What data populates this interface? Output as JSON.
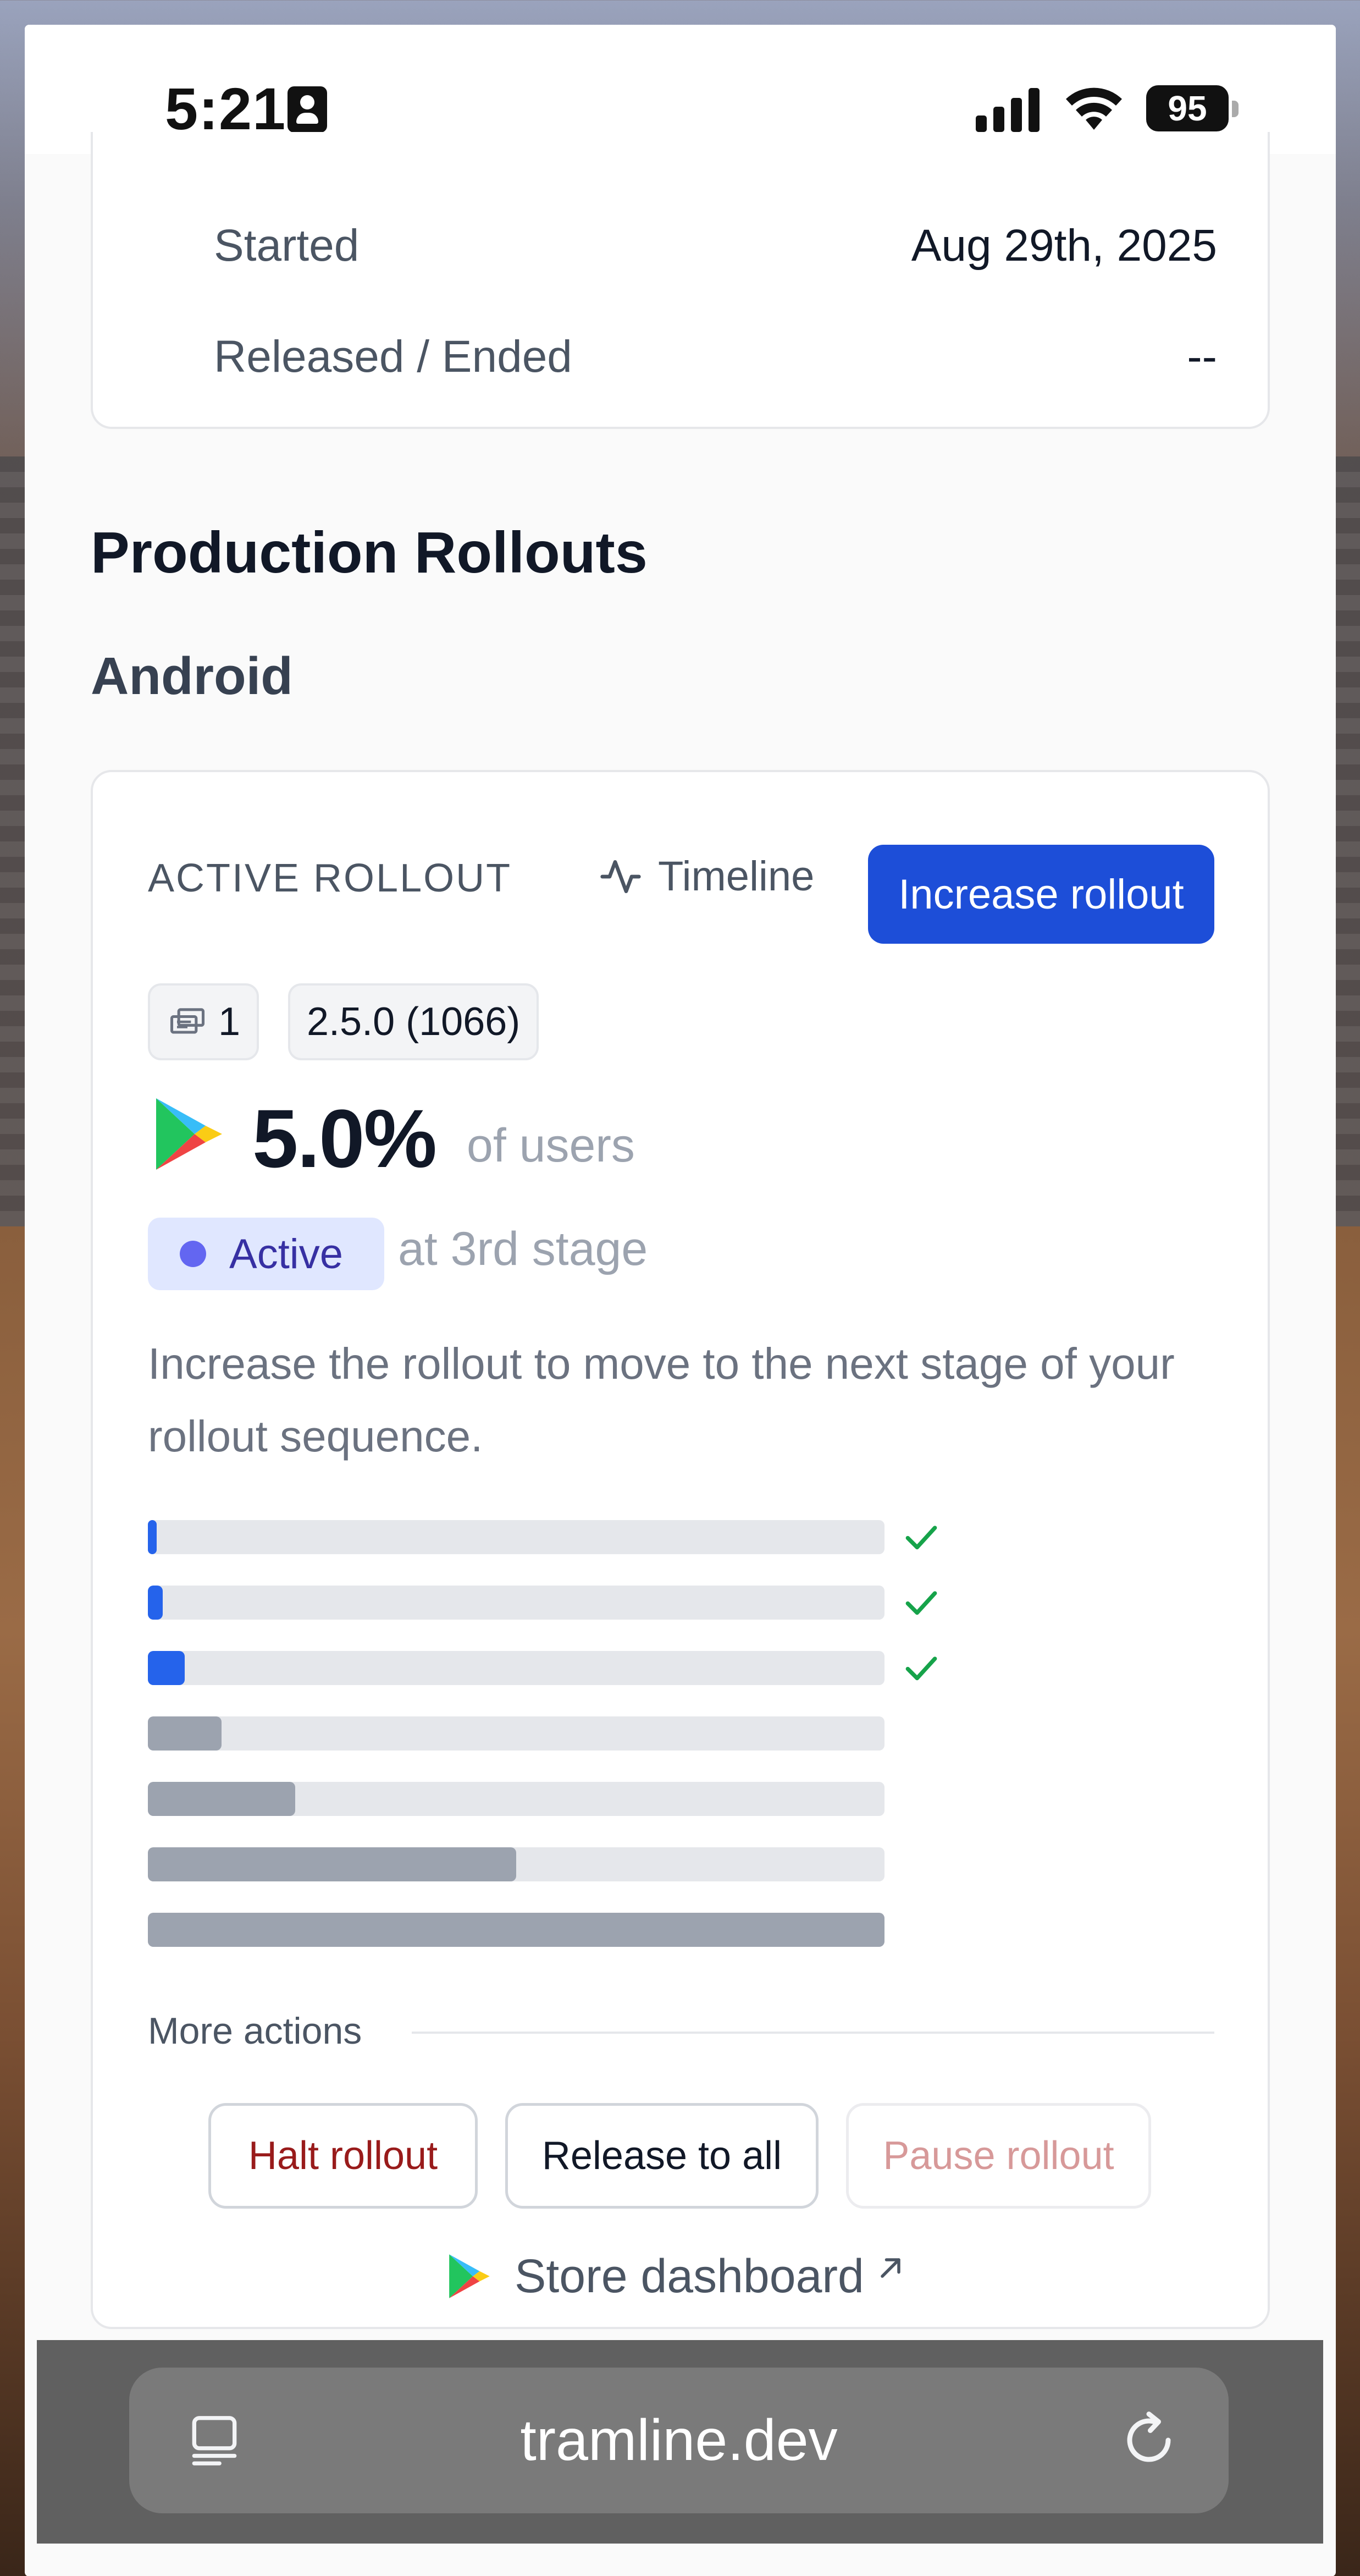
{
  "status_bar": {
    "time": "5:21",
    "battery": "95"
  },
  "summary_card": {
    "rows": [
      {
        "label": "Started",
        "value": "Aug 29th, 2025"
      },
      {
        "label": "Released / Ended",
        "value": "--"
      }
    ]
  },
  "production": {
    "title": "Production Rollouts",
    "platform": "Android"
  },
  "rollout_card": {
    "label": "ACTIVE ROLLOUT",
    "timeline_label": "Timeline",
    "increase_button": "Increase rollout",
    "build_count": "1",
    "version": "2.5.0 (1066)",
    "percentage": "5.0%",
    "percentage_suffix": "of users",
    "status": "Active",
    "stage_text": "at 3rd stage",
    "description": "Increase the rollout to move to the next stage of your rollout sequence.",
    "stages": [
      {
        "percent": 1,
        "completed": true
      },
      {
        "percent": 2,
        "completed": true
      },
      {
        "percent": 5,
        "completed": true
      },
      {
        "percent": 10,
        "completed": false
      },
      {
        "percent": 20,
        "completed": false
      },
      {
        "percent": 50,
        "completed": false
      },
      {
        "percent": 100,
        "completed": false
      }
    ],
    "colors": {
      "stage_done": "#2563eb",
      "stage_pending": "#9ca3af",
      "check": "#16a34a",
      "accent": "#1d4ed8"
    },
    "more_actions_label": "More actions",
    "actions": {
      "halt": "Halt rollout",
      "release": "Release to all",
      "pause": "Pause rollout"
    },
    "store_link": "Store dashboard"
  },
  "browser": {
    "url": "tramline.dev"
  }
}
